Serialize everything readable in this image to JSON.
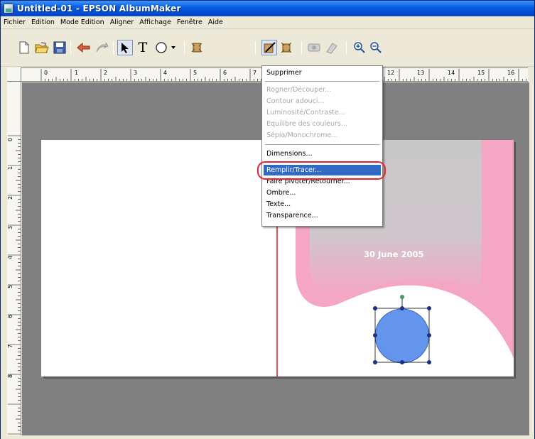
{
  "window": {
    "title": "Untitled-01 - EPSON AlbumMaker"
  },
  "menubar": {
    "items": [
      "Fichier",
      "Edition",
      "Mode Edition",
      "Aligner",
      "Affichage",
      "Fenêtre",
      "Aide"
    ]
  },
  "toolbar": {
    "icons": [
      "new-document-icon",
      "open-folder-icon",
      "save-icon",
      "undo-icon",
      "redo-icon",
      "select-arrow-icon",
      "text-tool-icon",
      "shape-tool-icon",
      "photo-frame-icon",
      "image-edit-icon",
      "image-effect-icon",
      "clipart-icon",
      "background-icon",
      "zoom-in-icon",
      "zoom-out-icon"
    ],
    "text_tool_label": "T"
  },
  "rulers": {
    "horizontal_labels": [
      "0",
      "1",
      "2",
      "3",
      "4",
      "5",
      "6",
      "7",
      "12",
      "13",
      "14",
      "15",
      "16"
    ],
    "vertical_labels": [
      "0",
      "1",
      "2",
      "3",
      "4",
      "5",
      "6",
      "7",
      "8"
    ]
  },
  "page": {
    "date_text": "30 June 2005",
    "accent_color": "#f4a6c4",
    "gray_panel_color": "#c8c8c8",
    "circle_fill_color": "#6495ed",
    "fold_line_color": "#e8232d"
  },
  "dropdown": {
    "items": [
      {
        "label": "Supprimer",
        "state": "normal"
      },
      {
        "label": "Rogner/Découper...",
        "state": "disabled"
      },
      {
        "label": "Contour adouci...",
        "state": "disabled"
      },
      {
        "label": "Luminosité/Contraste...",
        "state": "disabled"
      },
      {
        "label": "Equilibre des couleurs...",
        "state": "disabled"
      },
      {
        "label": "Sépia/Monochrome...",
        "state": "disabled"
      },
      {
        "label": "Dimensions...",
        "state": "normal"
      },
      {
        "label": "Remplir/Tracer...",
        "state": "highlighted"
      },
      {
        "label": "Faire pivoter/Retourner...",
        "state": "normal"
      },
      {
        "label": "Ombre...",
        "state": "normal"
      },
      {
        "label": "Texte...",
        "state": "normal"
      },
      {
        "label": "Transparence...",
        "state": "normal"
      }
    ],
    "highlight_color": "#316ac5",
    "callout_color": "#e8232d"
  }
}
